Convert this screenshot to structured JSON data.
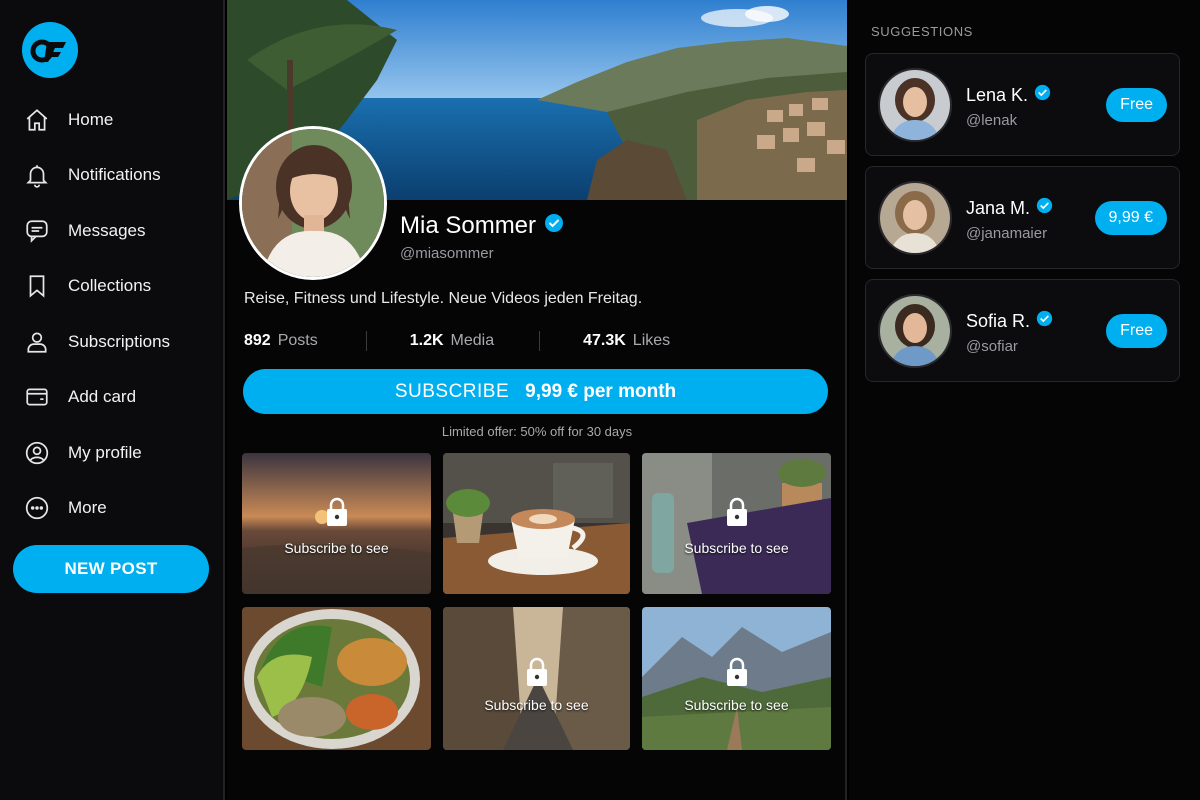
{
  "app": {
    "logo_text": "OF",
    "accent": "#00aff0"
  },
  "sidebar": {
    "items": [
      {
        "label": "Home",
        "icon": "home-icon"
      },
      {
        "label": "Notifications",
        "icon": "bell-icon"
      },
      {
        "label": "Messages",
        "icon": "chat-icon"
      },
      {
        "label": "Collections",
        "icon": "bookmark-icon"
      },
      {
        "label": "Subscriptions",
        "icon": "user-icon"
      },
      {
        "label": "Add card",
        "icon": "card-icon"
      },
      {
        "label": "My profile",
        "icon": "profile-icon"
      },
      {
        "label": "More",
        "icon": "more-icon"
      }
    ],
    "new_post_label": "NEW POST"
  },
  "profile": {
    "name": "Mia Sommer",
    "handle": "@miasommer",
    "bio": "Reise, Fitness und Lifestyle. Neue Videos jeden Freitag.",
    "stats": [
      {
        "value": "892",
        "label": "Posts"
      },
      {
        "value": "1.2K",
        "label": "Media"
      },
      {
        "value": "47.3K",
        "label": "Likes"
      }
    ],
    "subscribe_label": "SUBSCRIBE",
    "subscribe_price": "9,99 € per month",
    "offer": "Limited offer: 50% off for 30 days",
    "locked_text": "Subscribe to see"
  },
  "suggestions": {
    "title": "SUGGESTIONS",
    "items": [
      {
        "name": "Lena K.",
        "handle": "@lenak",
        "button": "Free"
      },
      {
        "name": "Jana M.",
        "handle": "@janamaier",
        "button": "9,99 €"
      },
      {
        "name": "Sofia R.",
        "handle": "@sofiar",
        "button": "Free"
      }
    ]
  }
}
